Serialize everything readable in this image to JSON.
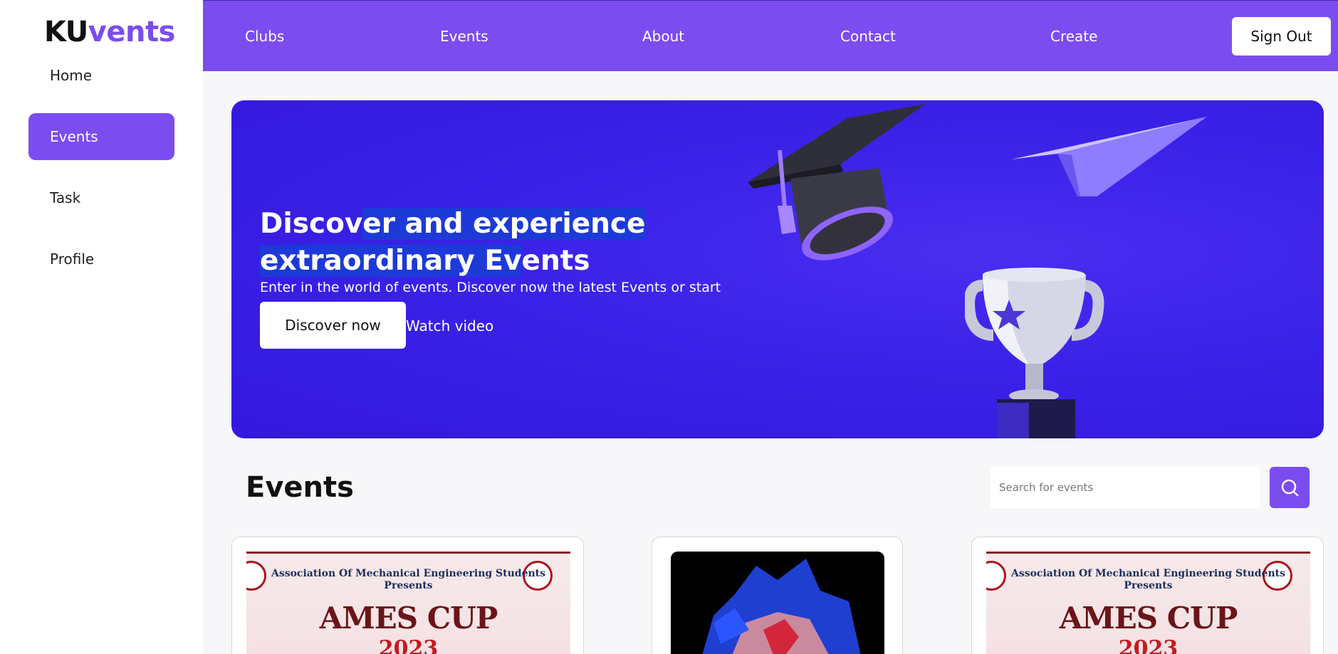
{
  "app": {
    "logo_part1": "KU",
    "logo_part2": "vents",
    "brand_color": "#7b4cf0"
  },
  "sidebar": {
    "items": [
      {
        "label": "Home"
      },
      {
        "label": "Events",
        "active": true
      },
      {
        "label": "Task"
      },
      {
        "label": "Profile"
      }
    ]
  },
  "topnav": {
    "links": [
      "Clubs",
      "Events",
      "About",
      "Contact",
      "Create"
    ],
    "signout_label": "Sign Out"
  },
  "hero": {
    "title_line1_a": "Discov",
    "title_line1_b": "er and experience",
    "title_line2_a": "extraordinary Ev",
    "title_line2_b": "ents",
    "subtitle": "Enter in the world of events. Discover now the latest Events or start",
    "discover_label": "Discover now",
    "watch_label": "Watch video"
  },
  "events_section": {
    "title": "Events",
    "search_placeholder": "Search for events",
    "search_icon": "search-icon"
  },
  "cards": [
    {
      "org": "Association Of Mechanical Engineering Students",
      "presents": "Presents",
      "title": "AMES CUP",
      "year": "2023"
    },
    {
      "org": "",
      "presents": "",
      "title": "",
      "year": ""
    },
    {
      "org": "Association Of Mechanical Engineering Students",
      "presents": "Presents",
      "title": "AMES CUP",
      "year": "2023"
    }
  ]
}
